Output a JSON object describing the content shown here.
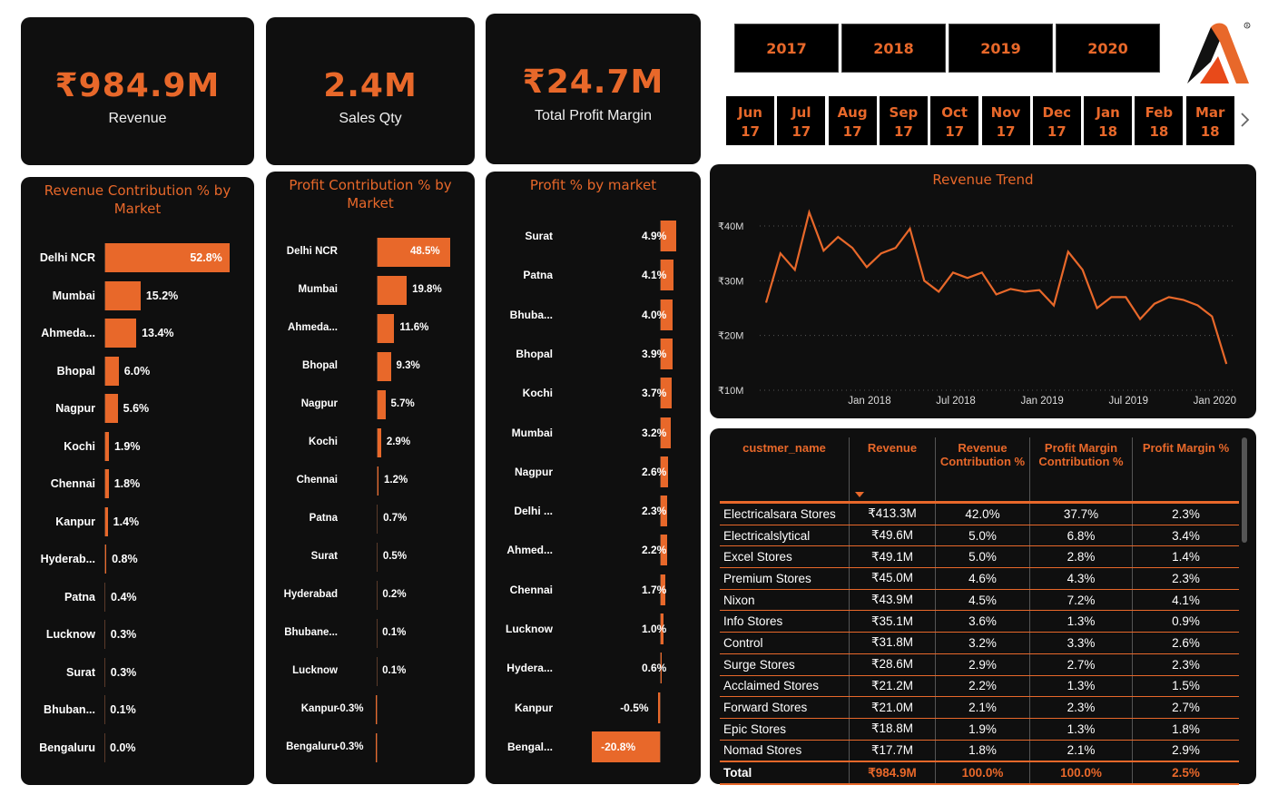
{
  "kpis": {
    "revenue": {
      "value": "₹984.9M",
      "label": "Revenue"
    },
    "sales_qty": {
      "value": "2.4M",
      "label": "Sales Qty"
    },
    "profit_margin": {
      "value": "₹24.7M",
      "label": "Total Profit Margin"
    }
  },
  "years": [
    "2017",
    "2018",
    "2019",
    "2020"
  ],
  "months": [
    {
      "m": "Jun",
      "y": "17"
    },
    {
      "m": "Jul",
      "y": "17"
    },
    {
      "m": "Aug",
      "y": "17"
    },
    {
      "m": "Sep",
      "y": "17"
    },
    {
      "m": "Oct",
      "y": "17"
    },
    {
      "m": "Nov",
      "y": "17"
    },
    {
      "m": "Dec",
      "y": "17"
    },
    {
      "m": "Jan",
      "y": "18"
    },
    {
      "m": "Feb",
      "y": "18"
    },
    {
      "m": "Mar",
      "y": "18"
    }
  ],
  "month_next_icon": "chevron-right-icon",
  "logo_icon": "logo-a-icon",
  "colors": {
    "accent": "#e8682a",
    "panel": "#0f0f0f"
  },
  "revenue_contribution": {
    "title": "Revenue Contribution % by Market",
    "bars": [
      {
        "label": "Delhi NCR",
        "value": 52.8,
        "text": "52.8%"
      },
      {
        "label": "Mumbai",
        "value": 15.2,
        "text": "15.2%"
      },
      {
        "label": "Ahmeda...",
        "value": 13.4,
        "text": "13.4%"
      },
      {
        "label": "Bhopal",
        "value": 6.0,
        "text": "6.0%"
      },
      {
        "label": "Nagpur",
        "value": 5.6,
        "text": "5.6%"
      },
      {
        "label": "Kochi",
        "value": 1.9,
        "text": "1.9%"
      },
      {
        "label": "Chennai",
        "value": 1.8,
        "text": "1.8%"
      },
      {
        "label": "Kanpur",
        "value": 1.4,
        "text": "1.4%"
      },
      {
        "label": "Hyderab...",
        "value": 0.8,
        "text": "0.8%"
      },
      {
        "label": "Patna",
        "value": 0.4,
        "text": "0.4%"
      },
      {
        "label": "Lucknow",
        "value": 0.3,
        "text": "0.3%"
      },
      {
        "label": "Surat",
        "value": 0.3,
        "text": "0.3%"
      },
      {
        "label": "Bhuban...",
        "value": 0.1,
        "text": "0.1%"
      },
      {
        "label": "Bengaluru",
        "value": 0.0,
        "text": "0.0%"
      }
    ]
  },
  "profit_contribution": {
    "title": "Profit Contribution % by Market",
    "bars": [
      {
        "label": "Delhi NCR",
        "value": 48.5,
        "text": "48.5%"
      },
      {
        "label": "Mumbai",
        "value": 19.8,
        "text": "19.8%"
      },
      {
        "label": "Ahmeda...",
        "value": 11.6,
        "text": "11.6%"
      },
      {
        "label": "Bhopal",
        "value": 9.3,
        "text": "9.3%"
      },
      {
        "label": "Nagpur",
        "value": 5.7,
        "text": "5.7%"
      },
      {
        "label": "Kochi",
        "value": 2.9,
        "text": "2.9%"
      },
      {
        "label": "Chennai",
        "value": 1.2,
        "text": "1.2%"
      },
      {
        "label": "Patna",
        "value": 0.7,
        "text": "0.7%"
      },
      {
        "label": "Surat",
        "value": 0.5,
        "text": "0.5%"
      },
      {
        "label": "Hyderabad",
        "value": 0.2,
        "text": "0.2%"
      },
      {
        "label": "Bhubane...",
        "value": 0.1,
        "text": "0.1%"
      },
      {
        "label": "Lucknow",
        "value": 0.1,
        "text": "0.1%"
      },
      {
        "label": "Kanpur",
        "value": -0.3,
        "text": "-0.3%"
      },
      {
        "label": "Bengaluru",
        "value": -0.3,
        "text": "-0.3%"
      }
    ]
  },
  "profit_pct": {
    "title": "Profit % by market",
    "bars": [
      {
        "label": "Surat",
        "value": 4.9,
        "text": "4.9%"
      },
      {
        "label": "Patna",
        "value": 4.1,
        "text": "4.1%"
      },
      {
        "label": "Bhuba...",
        "value": 4.0,
        "text": "4.0%"
      },
      {
        "label": "Bhopal",
        "value": 3.9,
        "text": "3.9%"
      },
      {
        "label": "Kochi",
        "value": 3.7,
        "text": "3.7%"
      },
      {
        "label": "Mumbai",
        "value": 3.2,
        "text": "3.2%"
      },
      {
        "label": "Nagpur",
        "value": 2.6,
        "text": "2.6%"
      },
      {
        "label": "Delhi ...",
        "value": 2.3,
        "text": "2.3%"
      },
      {
        "label": "Ahmed...",
        "value": 2.2,
        "text": "2.2%"
      },
      {
        "label": "Chennai",
        "value": 1.7,
        "text": "1.7%"
      },
      {
        "label": "Lucknow",
        "value": 1.0,
        "text": "1.0%"
      },
      {
        "label": "Hydera...",
        "value": 0.6,
        "text": "0.6%"
      },
      {
        "label": "Kanpur",
        "value": -0.5,
        "text": "-0.5%"
      },
      {
        "label": "Bengal...",
        "value": -20.8,
        "text": "-20.8%"
      }
    ]
  },
  "chart_data": {
    "type": "line",
    "title": "Revenue Trend",
    "y_ticks": [
      "₹10M",
      "₹20M",
      "₹30M",
      "₹40M"
    ],
    "y_tick_values": [
      10,
      20,
      30,
      40
    ],
    "ylim": [
      10,
      43
    ],
    "x_ticks": [
      "Jan 2018",
      "Jul 2018",
      "Jan 2019",
      "Jul 2019",
      "Jan 2020"
    ],
    "x_tick_index": [
      7,
      13,
      19,
      25,
      31
    ],
    "values": [
      26,
      35,
      32,
      42.5,
      35.5,
      38,
      36,
      32.5,
      35,
      36,
      39.5,
      30,
      28,
      31.5,
      30.5,
      31.5,
      27.5,
      28.5,
      28,
      28.3,
      25.5,
      35.3,
      32,
      25,
      27,
      27,
      23,
      25.8,
      27,
      26.5,
      25.5,
      23.5,
      14.8
    ],
    "series_unit": "₹M",
    "grid": true
  },
  "table": {
    "headers": [
      "custmer_name",
      "Revenue",
      "Revenue Contribution %",
      "Profit Margin Contribution %",
      "Profit Margin %"
    ],
    "sort_icon": "sort-down-icon",
    "rows": [
      [
        "Electricalsara Stores",
        "₹413.3M",
        "42.0%",
        "37.7%",
        "2.3%"
      ],
      [
        "Electricalslytical",
        "₹49.6M",
        "5.0%",
        "6.8%",
        "3.4%"
      ],
      [
        "Excel Stores",
        "₹49.1M",
        "5.0%",
        "2.8%",
        "1.4%"
      ],
      [
        "Premium Stores",
        "₹45.0M",
        "4.6%",
        "4.3%",
        "2.3%"
      ],
      [
        "Nixon",
        "₹43.9M",
        "4.5%",
        "7.2%",
        "4.1%"
      ],
      [
        "Info Stores",
        "₹35.1M",
        "3.6%",
        "1.3%",
        "0.9%"
      ],
      [
        "Control",
        "₹31.8M",
        "3.2%",
        "3.3%",
        "2.6%"
      ],
      [
        "Surge Stores",
        "₹28.6M",
        "2.9%",
        "2.7%",
        "2.3%"
      ],
      [
        "Acclaimed Stores",
        "₹21.2M",
        "2.2%",
        "1.3%",
        "1.5%"
      ],
      [
        "Forward Stores",
        "₹21.0M",
        "2.1%",
        "2.3%",
        "2.7%"
      ],
      [
        "Epic Stores",
        "₹18.8M",
        "1.9%",
        "1.3%",
        "1.8%"
      ],
      [
        "Nomad Stores",
        "₹17.7M",
        "1.8%",
        "2.1%",
        "2.9%"
      ]
    ],
    "total": [
      "Total",
      "₹984.9M",
      "100.0%",
      "100.0%",
      "2.5%"
    ]
  }
}
